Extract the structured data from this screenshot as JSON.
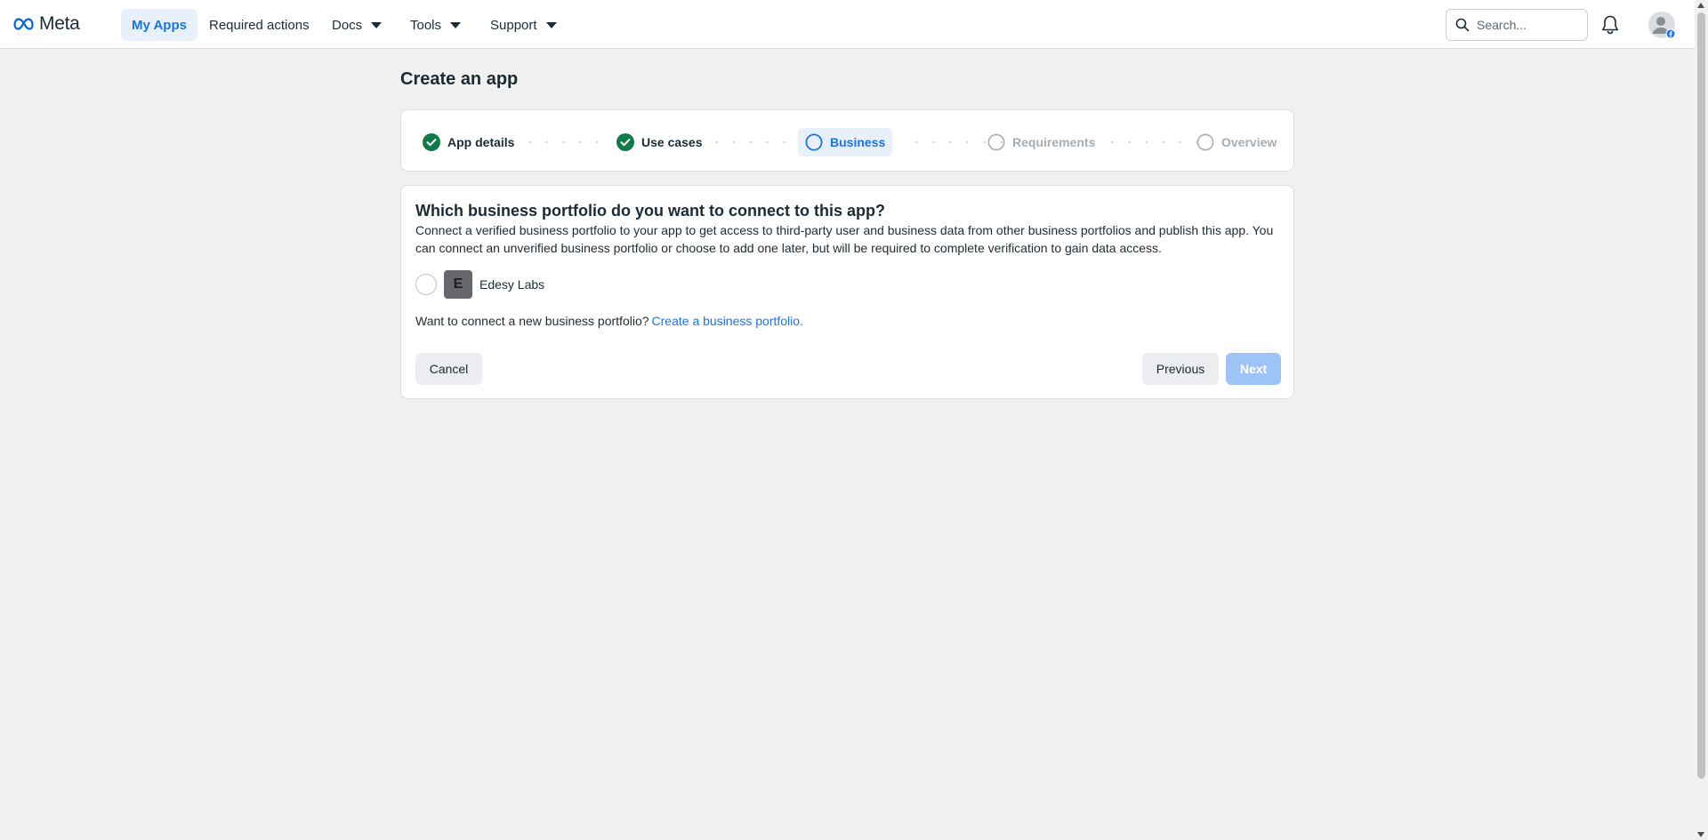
{
  "topnav": {
    "brand": "Meta",
    "items": [
      {
        "label": "My Apps",
        "active": true,
        "has_dropdown": false
      },
      {
        "label": "Required actions",
        "active": false,
        "has_dropdown": false
      },
      {
        "label": "Docs",
        "active": false,
        "has_dropdown": true
      },
      {
        "label": "Tools",
        "active": false,
        "has_dropdown": true
      },
      {
        "label": "Support",
        "active": false,
        "has_dropdown": true
      }
    ],
    "search_placeholder": "Search...",
    "icons": [
      "search-icon",
      "bell-icon",
      "profile-avatar-icon"
    ]
  },
  "page": {
    "title": "Create an app"
  },
  "stepper": {
    "steps": [
      {
        "label": "App details",
        "state": "done"
      },
      {
        "label": "Use cases",
        "state": "done"
      },
      {
        "label": "Business",
        "state": "current"
      },
      {
        "label": "Requirements",
        "state": "pending"
      },
      {
        "label": "Overview",
        "state": "pending"
      }
    ]
  },
  "business": {
    "question": "Which business portfolio do you want to connect to this app?",
    "description": "Connect a verified business portfolio to your app to get access to third-party user and business data from other business portfolios and publish this app. You can connect an unverified business portfolio or choose to add one later, but will be required to complete verification to gain data access.",
    "portfolios": [
      {
        "initial": "E",
        "name": "Edesy Labs",
        "selected": false
      }
    ],
    "connect_prompt": "Want to connect a new business portfolio?",
    "connect_link": "Create a business portfolio."
  },
  "actions": {
    "cancel": "Cancel",
    "previous": "Previous",
    "next": "Next",
    "next_disabled": true
  },
  "colors": {
    "accent": "#1b74e4",
    "success": "#117a4a",
    "page_bg": "#f1f1f1",
    "disabled_primary": "#9ec3f7"
  }
}
